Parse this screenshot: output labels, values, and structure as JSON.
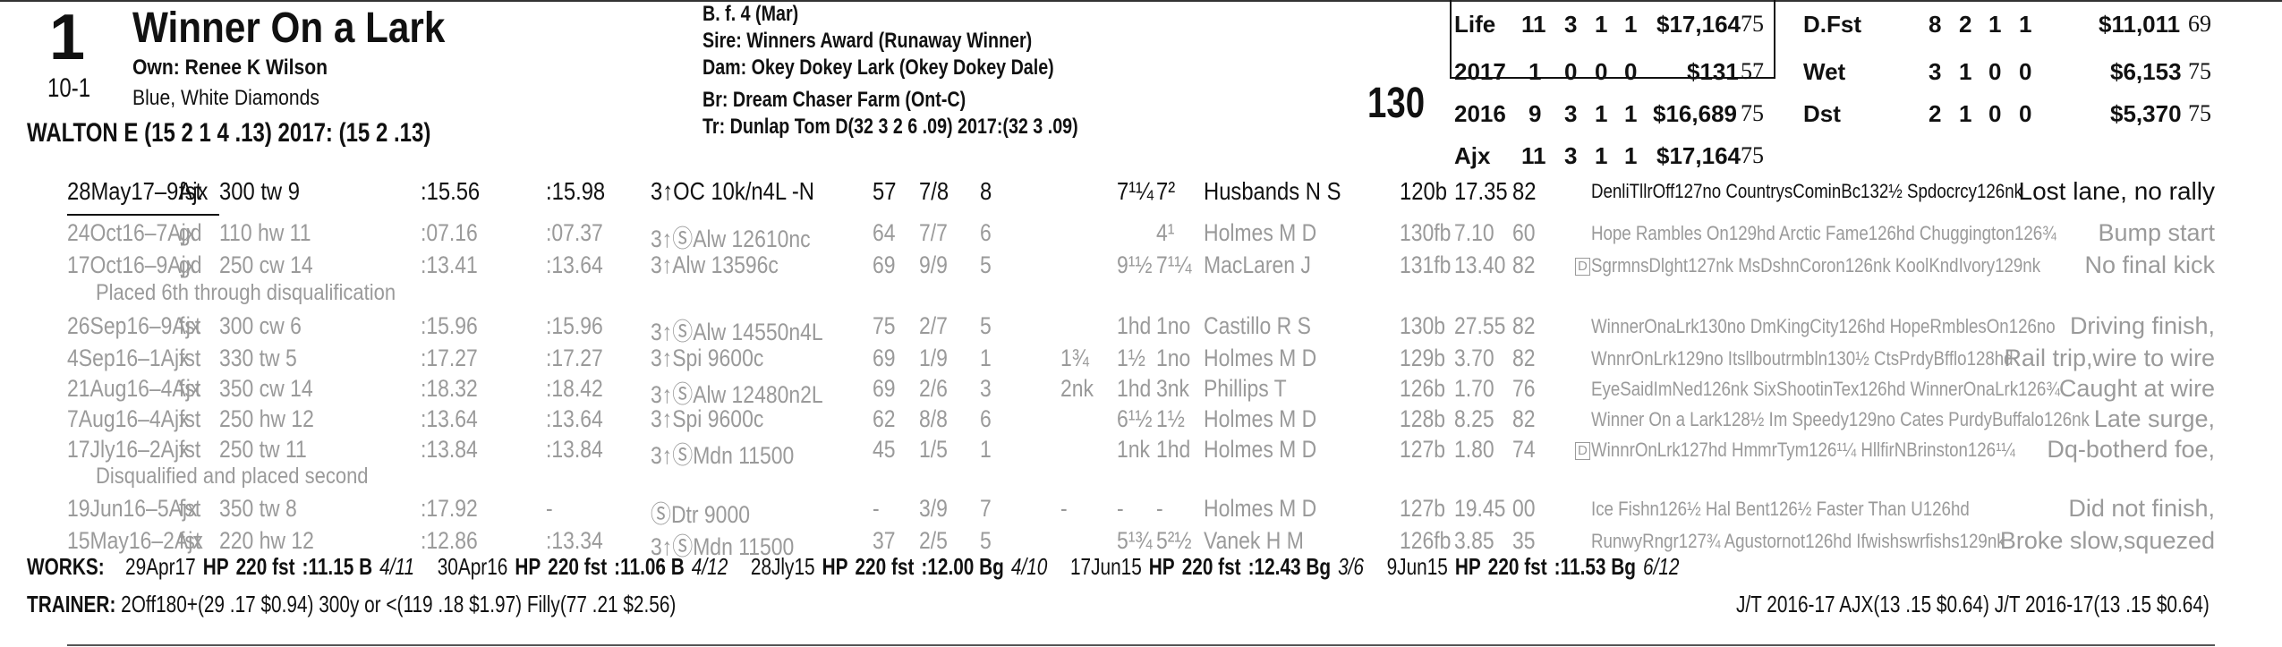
{
  "header": {
    "post_position": "1",
    "morning_line": "10-1",
    "horse_name": "Winner On a Lark",
    "owner": "Own: Renee K Wilson",
    "silks": "Blue, White Diamonds",
    "jockey": "WALTON E (15 2 1 4 .13) 2017: (15 2 .13)",
    "sex_age": "B. f. 4 (Mar)",
    "sire": "Sire: Winners Award (Runaway Winner)",
    "dam": "Dam: Okey Dokey Lark (Okey Dokey Dale)",
    "breeder": "Br:   Dream Chaser Farm (Ont-C)",
    "trainer": "Tr:   Dunlap Tom D(32 3 2 6 .09)  2017:(32 3 .09)",
    "prime_power": "130"
  },
  "records_left": [
    {
      "label": "Life",
      "st": "11",
      "w": "3",
      "p": "1",
      "s": "1",
      "earn": "$17,164",
      "spd": "75"
    },
    {
      "label": "2017",
      "st": "1",
      "w": "0",
      "p": "0",
      "s": "0",
      "earn": "$131",
      "spd": "57"
    },
    {
      "label": "2016",
      "st": "9",
      "w": "3",
      "p": "1",
      "s": "1",
      "earn": "$16,689",
      "spd": "75"
    },
    {
      "label": "Ajx",
      "st": "11",
      "w": "3",
      "p": "1",
      "s": "1",
      "earn": "$17,164",
      "spd": "75"
    }
  ],
  "records_right": [
    {
      "label": "D.Fst",
      "st": "8",
      "w": "2",
      "p": "1",
      "s": "1",
      "earn": "$11,011",
      "spd": "69"
    },
    {
      "label": "Wet",
      "st": "3",
      "w": "1",
      "p": "0",
      "s": "0",
      "earn": "$6,153",
      "spd": "75"
    },
    {
      "label": "Dst",
      "st": "2",
      "w": "1",
      "p": "0",
      "s": "0",
      "earn": "$5,370",
      "spd": "75"
    }
  ],
  "past_performances": [
    {
      "date": "28May17–9Ajx",
      "cond": "fst",
      "dist": "300 tw 9",
      "frac1": ":15.56",
      "frac2": ":15.98",
      "race": "3↑OC 10k/n4L -N",
      "spd": "57",
      "pp": "7/8",
      "st": "8",
      "c1": "",
      "c2": "7¹¼",
      "fin": "7²",
      "jockey": "Husbands N S",
      "wt": "120b",
      "odds": "17.35",
      "pr": "82",
      "comp": "DenliTllrOff127no CountrysCominBc132½ Spdocrcy126nk",
      "comment": "Lost lane, no rally"
    },
    {
      "date": "24Oct16–7Ajx",
      "cond": "gd",
      "dist": "110 hw 11",
      "frac1": ":07.16",
      "frac2": ":07.37",
      "race": "3↑ⓈAlw 12610nc",
      "spd": "64",
      "pp": "7/7",
      "st": "6",
      "c1": "",
      "c2": "",
      "fin": "4¹",
      "jockey": "Holmes M D",
      "wt": "130fb",
      "odds": "7.10",
      "pr": "60",
      "comp": "Hope Rambles On129hd Arctic Fame126hd Chuggington126¾",
      "comment": "Bump start"
    },
    {
      "date": "17Oct16–9Ajx",
      "cond": "gd",
      "dist": "250 cw 14",
      "frac1": ":13.41",
      "frac2": ":13.64",
      "race": "3↑Alw 13596c",
      "spd": "69",
      "pp": "9/9",
      "st": "5",
      "c1": "",
      "c2": "9¹½",
      "fin": "7¹¼",
      "jockey": "MacLaren J",
      "wt": "131fb",
      "odds": "13.40",
      "pr": "82",
      "comp": "SgrmnsDlght127nk MsDshnCoron126nk KoolKndIvory129nk",
      "comment": "No final kick"
    },
    {
      "date": "26Sep16–9Ajx",
      "cond": "fst",
      "dist": "300 cw 6",
      "frac1": ":15.96",
      "frac2": ":15.96",
      "race": "3↑ⓈAlw 14550n4L",
      "spd": "75",
      "pp": "2/7",
      "st": "5",
      "c1": "",
      "c2": "1hd",
      "fin": "1no",
      "jockey": "Castillo R S",
      "wt": "130b",
      "odds": "27.55",
      "pr": "82",
      "comp": "WinnerOnaLrk130no DmKingCity126hd HopeRmblesOn126no",
      "comment": "Driving finish,"
    },
    {
      "date": "4Sep16–1Ajx",
      "cond": "fst",
      "dist": "330 tw 5",
      "frac1": ":17.27",
      "frac2": ":17.27",
      "race": "3↑Spi 9600c",
      "spd": "69",
      "pp": "1/9",
      "st": "1",
      "c1": "1¾",
      "c2": "1½",
      "fin": "1no",
      "jockey": "Holmes M D",
      "wt": "129b",
      "odds": "3.70",
      "pr": "82",
      "comp": "WnnrOnLrk129no Itsllboutrmbln130½ CtsPrdyBfflo128hd",
      "comment": "Rail trip,wire to wire"
    },
    {
      "date": "21Aug16–4Ajx",
      "cond": "fst",
      "dist": "350 cw 14",
      "frac1": ":18.32",
      "frac2": ":18.42",
      "race": "3↑ⓈAlw 12480n2L",
      "spd": "69",
      "pp": "2/6",
      "st": "3",
      "c1": "2nk",
      "c2": "1hd",
      "fin": "3nk",
      "jockey": "Phillips T",
      "wt": "126b",
      "odds": "1.70",
      "pr": "76",
      "comp": "EyeSaidImNed126nk SixShootinTex126hd WinnerOnaLrk126¾",
      "comment": "Caught at wire"
    },
    {
      "date": "7Aug16–4Ajx",
      "cond": "fst",
      "dist": "250 hw 12",
      "frac1": ":13.64",
      "frac2": ":13.64",
      "race": "3↑Spi 9600c",
      "spd": "62",
      "pp": "8/8",
      "st": "6",
      "c1": "",
      "c2": "6¹½",
      "fin": "1½",
      "jockey": "Holmes M D",
      "wt": "128b",
      "odds": "8.25",
      "pr": "82",
      "comp": "Winner On a Lark128½ Im Speedy129no Cates PurdyBuffalo126nk",
      "comment": "Late surge,"
    },
    {
      "date": "17Jly16–2Ajx",
      "cond": "fst",
      "dist": "250 tw 11",
      "frac1": ":13.84",
      "frac2": ":13.84",
      "race": "3↑ⓈMdn 11500",
      "spd": "45",
      "pp": "1/5",
      "st": "1",
      "c1": "",
      "c2": "1nk",
      "fin": "1hd",
      "jockey": "Holmes M D",
      "wt": "127b",
      "odds": "1.80",
      "pr": "74",
      "comp": "WinnrOnLrk127hd HmmrTym126¹¼ HllfirNBrinston126¹¼",
      "comment": "Dq-botherd foe,"
    },
    {
      "date": "19Jun16–5Ajx",
      "cond": "fst",
      "dist": "350 tw 8",
      "frac1": ":17.92",
      "frac2": "-",
      "race": "ⓈDtr 9000",
      "spd": "-",
      "pp": "3/9",
      "st": "7",
      "c1": "-",
      "c2": "-",
      "fin": "-",
      "jockey": "Holmes M D",
      "wt": "127b",
      "odds": "19.45",
      "pr": "00",
      "comp": "Ice Fishn126½ Hal Bent126½ Faster Than U126hd",
      "comment": "Did not finish,"
    },
    {
      "date": "15May16–2Ajx",
      "cond": "fst",
      "dist": "220 hw 12",
      "frac1": ":12.86",
      "frac2": ":13.34",
      "race": "3↑ⓈMdn 11500",
      "spd": "37",
      "pp": "2/5",
      "st": "5",
      "c1": "",
      "c2": "5¹¾",
      "fin": "5²½",
      "jockey": "Vanek H M",
      "wt": "126fb",
      "odds": "3.85",
      "pr": "35",
      "comp": "RunwyRngr127¾ Agustornot126hd Ifwishswrfishs129nk",
      "comment": "Broke slow,squezed"
    }
  ],
  "notes": {
    "dq_note1": "Placed 6th through disqualification",
    "dq_note2": "Disqualified and placed second",
    "dq_mark": "D"
  },
  "works": {
    "label": "WORKS:",
    "items": [
      {
        "date": "29Apr17",
        "trk": "HP",
        "dist": "220 fst",
        "time": ":11.15 B",
        "rank": "4/11"
      },
      {
        "date": "30Apr16",
        "trk": "HP",
        "dist": "220 fst",
        "time": ":11.06 B",
        "rank": "4/12"
      },
      {
        "date": "28Jly15",
        "trk": "HP",
        "dist": "220 fst",
        "time": ":12.00 Bg",
        "rank": "4/10"
      },
      {
        "date": "17Jun15",
        "trk": "HP",
        "dist": "220 fst",
        "time": ":12.43 Bg",
        "rank": "3/6"
      },
      {
        "date": "9Jun15",
        "trk": "HP",
        "dist": "220 fst",
        "time": ":11.53 Bg",
        "rank": "6/12"
      }
    ]
  },
  "trainer_stats": {
    "label": "TRAINER:",
    "text": "2Off180+(29 .17 $0.94) 300y or <(119 .18 $1.97) Filly(77 .21 $2.56)",
    "jt": "J/T 2016-17 AJX(13 .15 $0.64)  J/T 2016-17(13 .15 $0.64)"
  }
}
